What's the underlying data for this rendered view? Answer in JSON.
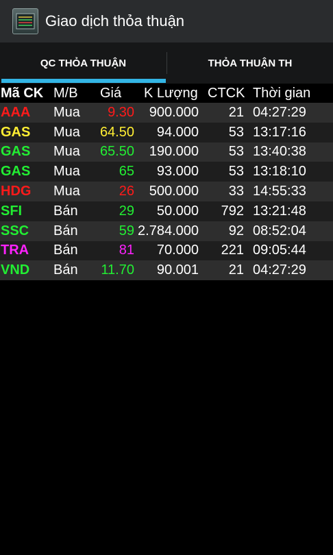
{
  "app": {
    "title": "Giao dịch thỏa thuận",
    "icon": "board-icon"
  },
  "tabs": [
    {
      "label": "QC THỎA THUẬN",
      "active": true
    },
    {
      "label": "THỎA THUẬN TH",
      "active": false
    }
  ],
  "colors": {
    "accent": "#33b5e5",
    "red": "#ff1a1a",
    "yellow": "#ffee33",
    "green": "#22ee33",
    "magenta": "#ff22ff",
    "white": "#ffffff"
  },
  "table": {
    "headers": {
      "code": "Mã CK",
      "side": "M/B",
      "price": "Giá",
      "volume": "K Lượng",
      "ctck": "CTCK",
      "time": "Thời gian"
    },
    "rows": [
      {
        "code": "AAA",
        "side": "Mua",
        "price": "9.30",
        "volume": "900.000",
        "ctck": "21",
        "time": "04:27:29",
        "color": "#ff1a1a"
      },
      {
        "code": "GAS",
        "side": "Mua",
        "price": "64.50",
        "volume": "94.000",
        "ctck": "53",
        "time": "13:17:16",
        "color": "#ffee33"
      },
      {
        "code": "GAS",
        "side": "Mua",
        "price": "65.50",
        "volume": "190.000",
        "ctck": "53",
        "time": "13:40:38",
        "color": "#22ee33"
      },
      {
        "code": "GAS",
        "side": "Mua",
        "price": "65",
        "volume": "93.000",
        "ctck": "53",
        "time": "13:18:10",
        "color": "#22ee33"
      },
      {
        "code": "HDG",
        "side": "Mua",
        "price": "26",
        "volume": "500.000",
        "ctck": "33",
        "time": "14:55:33",
        "color": "#ff1a1a"
      },
      {
        "code": "SFI",
        "side": "Bán",
        "price": "29",
        "volume": "50.000",
        "ctck": "792",
        "time": "13:21:48",
        "color": "#22ee33"
      },
      {
        "code": "SSC",
        "side": "Bán",
        "price": "59",
        "volume": "2.784.000",
        "ctck": "92",
        "time": "08:52:04",
        "color": "#22ee33"
      },
      {
        "code": "TRA",
        "side": "Bán",
        "price": "81",
        "volume": "70.000",
        "ctck": "221",
        "time": "09:05:44",
        "color": "#ff22ff"
      },
      {
        "code": "VND",
        "side": "Bán",
        "price": "11.70",
        "volume": "90.001",
        "ctck": "21",
        "time": "04:27:29",
        "color": "#22ee33"
      }
    ]
  }
}
